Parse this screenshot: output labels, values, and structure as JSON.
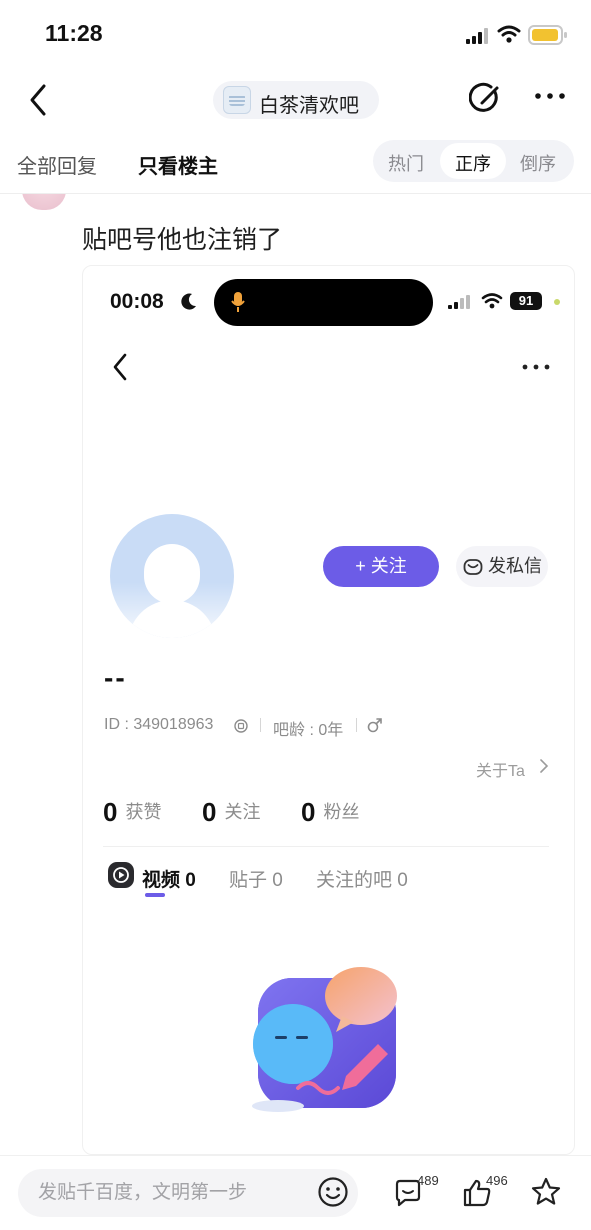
{
  "status_bar": {
    "time": "11:28"
  },
  "nav": {
    "title": "白茶清欢吧"
  },
  "filter": {
    "all_replies": "全部回复",
    "owner_only": "只看楼主",
    "hot": "热门",
    "asc": "正序",
    "desc": "倒序"
  },
  "post": {
    "text": "贴吧号他也注销了"
  },
  "screenshot": {
    "time": "00:08",
    "battery": "91",
    "follow_label": "+ 关注",
    "dm_label": "发私信",
    "username": "--",
    "id_text": "ID : 349018963",
    "age_text": "吧龄 : 0年",
    "about_label": "关于Ta",
    "stats": [
      {
        "num": "0",
        "label": "获赞"
      },
      {
        "num": "0",
        "label": "关注"
      },
      {
        "num": "0",
        "label": "粉丝"
      }
    ],
    "tabs": [
      {
        "label": "视频 0"
      },
      {
        "label": "贴子 0"
      },
      {
        "label": "关注的吧 0"
      }
    ]
  },
  "bottom": {
    "placeholder": "发贴千百度，文明第一步",
    "comments": "489",
    "likes": "496"
  },
  "colors": {
    "accent": "#6c5ce7",
    "avatar_blue": "#c9dcf6"
  }
}
